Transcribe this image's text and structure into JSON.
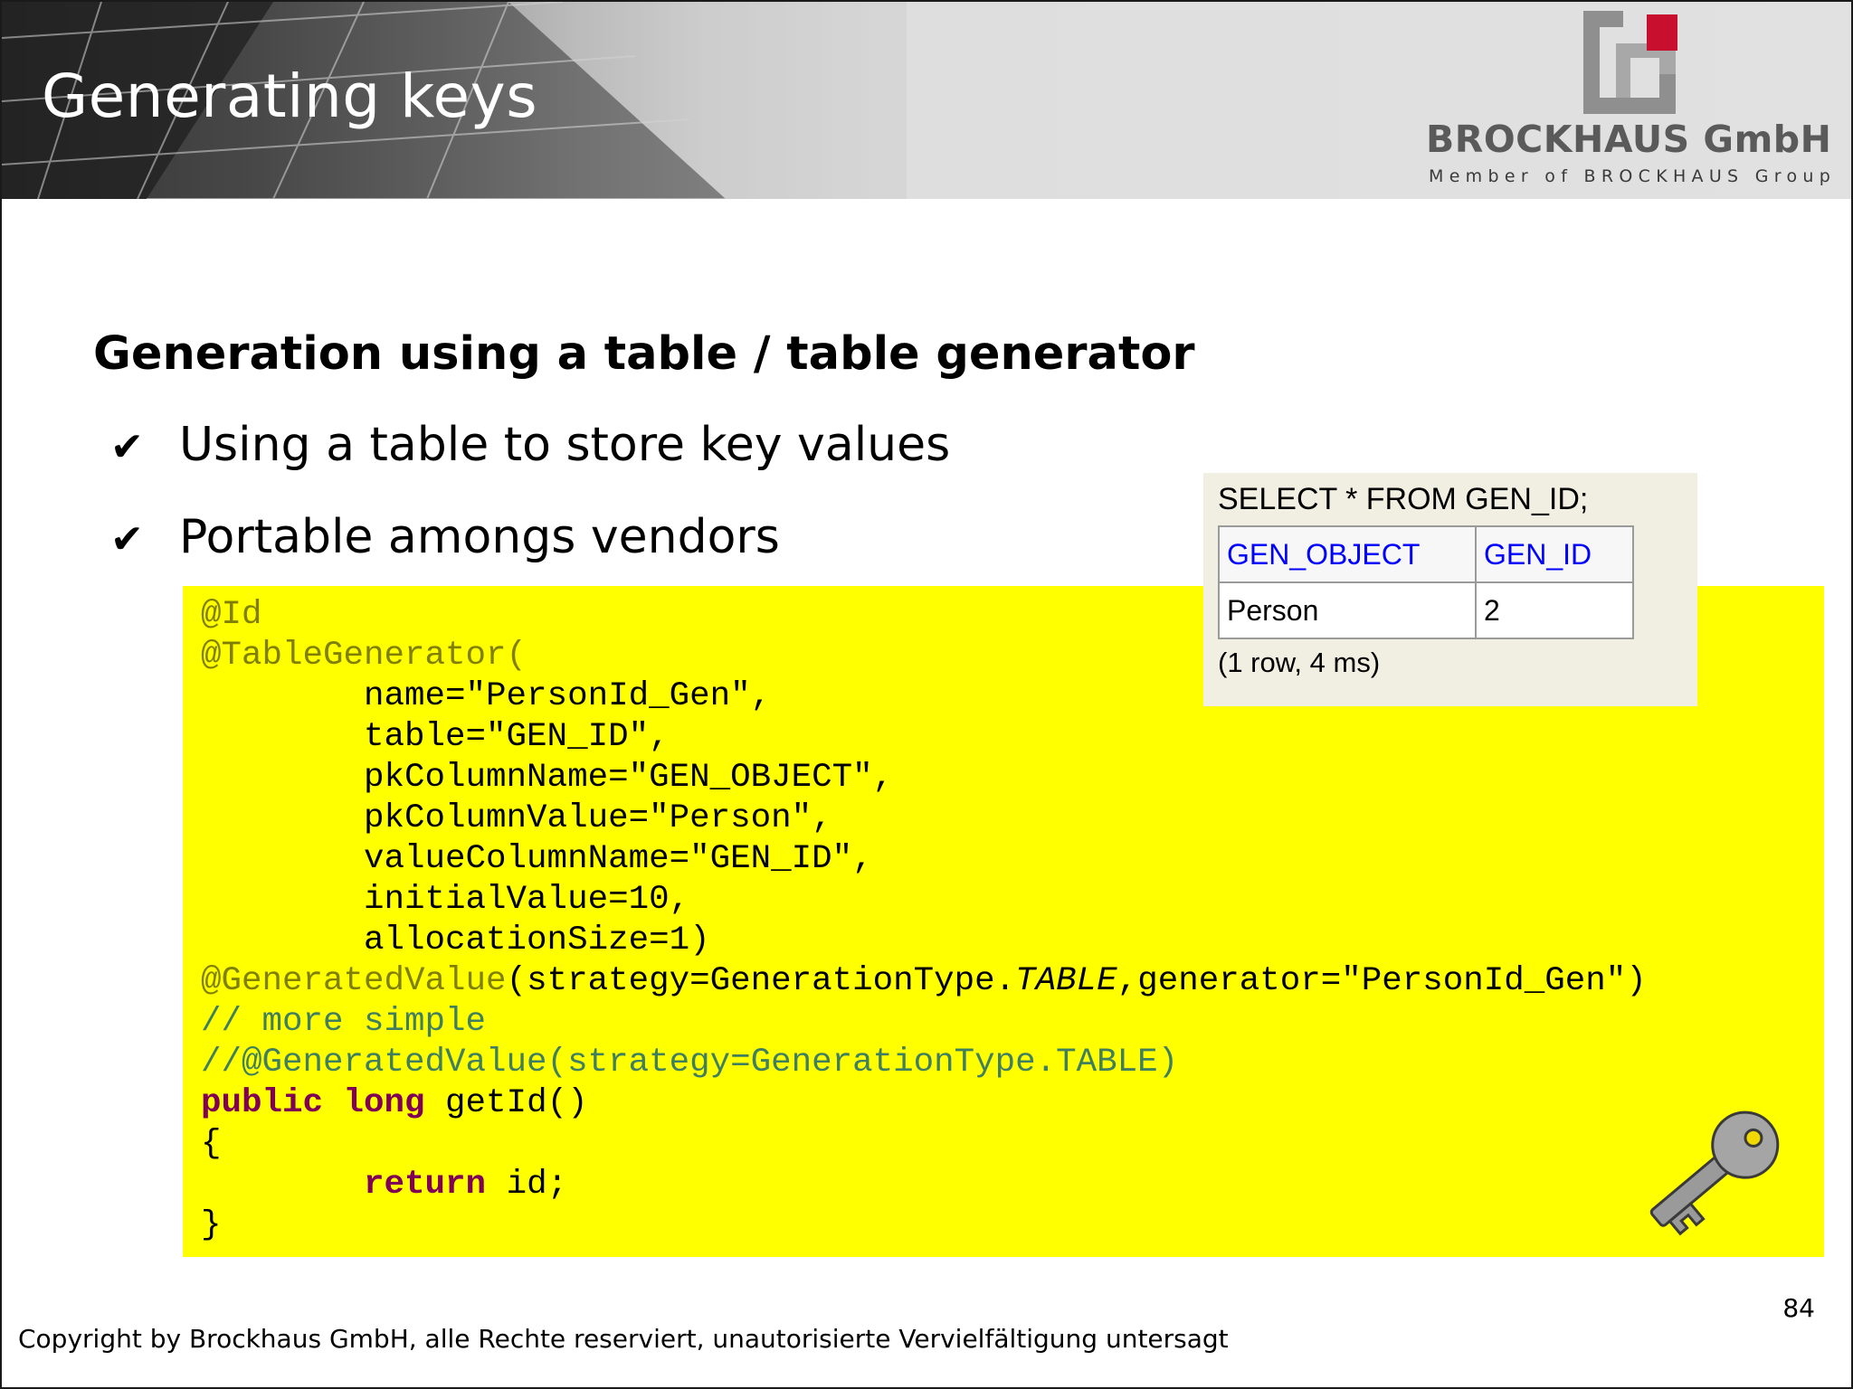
{
  "header": {
    "title": "Generating keys",
    "logo": {
      "name": "BROCKHAUS GmbH",
      "tagline": "Member of BROCKHAUS Group",
      "mark_color_gray": "#8f8f8f",
      "mark_color_red": "#c8102e"
    }
  },
  "content": {
    "heading": "Generation using a table / table generator",
    "bullets": [
      "Using a table to store key values",
      "Portable amongs vendors"
    ],
    "bullet_symbol": "✔",
    "code": {
      "background": "#ffff00",
      "lines": {
        "l1": "@Id",
        "l2": "@TableGenerator(",
        "l3": "        name=\"PersonId_Gen\",",
        "l4": "        table=\"GEN_ID\",",
        "l5": "        pkColumnName=\"GEN_OBJECT\",",
        "l6": "        pkColumnValue=\"Person\",",
        "l7": "        valueColumnName=\"GEN_ID\",",
        "l8": "        initialValue=10,",
        "l9": "        allocationSize=1)",
        "l10_ann": "@GeneratedValue",
        "l10_a": "(strategy=GenerationType.",
        "l10_it": "TABLE",
        "l10_b": ",generator=\"PersonId_Gen\")",
        "l11": "// more simple",
        "l12": "//@GeneratedValue(strategy=GenerationType.TABLE)",
        "l13_kw": "public long",
        "l13_rest": " getId()",
        "l14": "{",
        "l15_indent": "        ",
        "l15_kw": "return",
        "l15_rest": " id;",
        "l16": "}"
      }
    },
    "sql_result": {
      "query": "SELECT * FROM GEN_ID;",
      "columns": [
        "GEN_OBJECT",
        "GEN_ID"
      ],
      "rows": [
        [
          "Person",
          "2"
        ]
      ],
      "status": "(1 row, 4 ms)"
    },
    "key_icon": "key-icon"
  },
  "page_number": "84",
  "footer": "Copyright by Brockhaus GmbH, alle Rechte reserviert, unautorisierte Vervielfältigung untersagt"
}
